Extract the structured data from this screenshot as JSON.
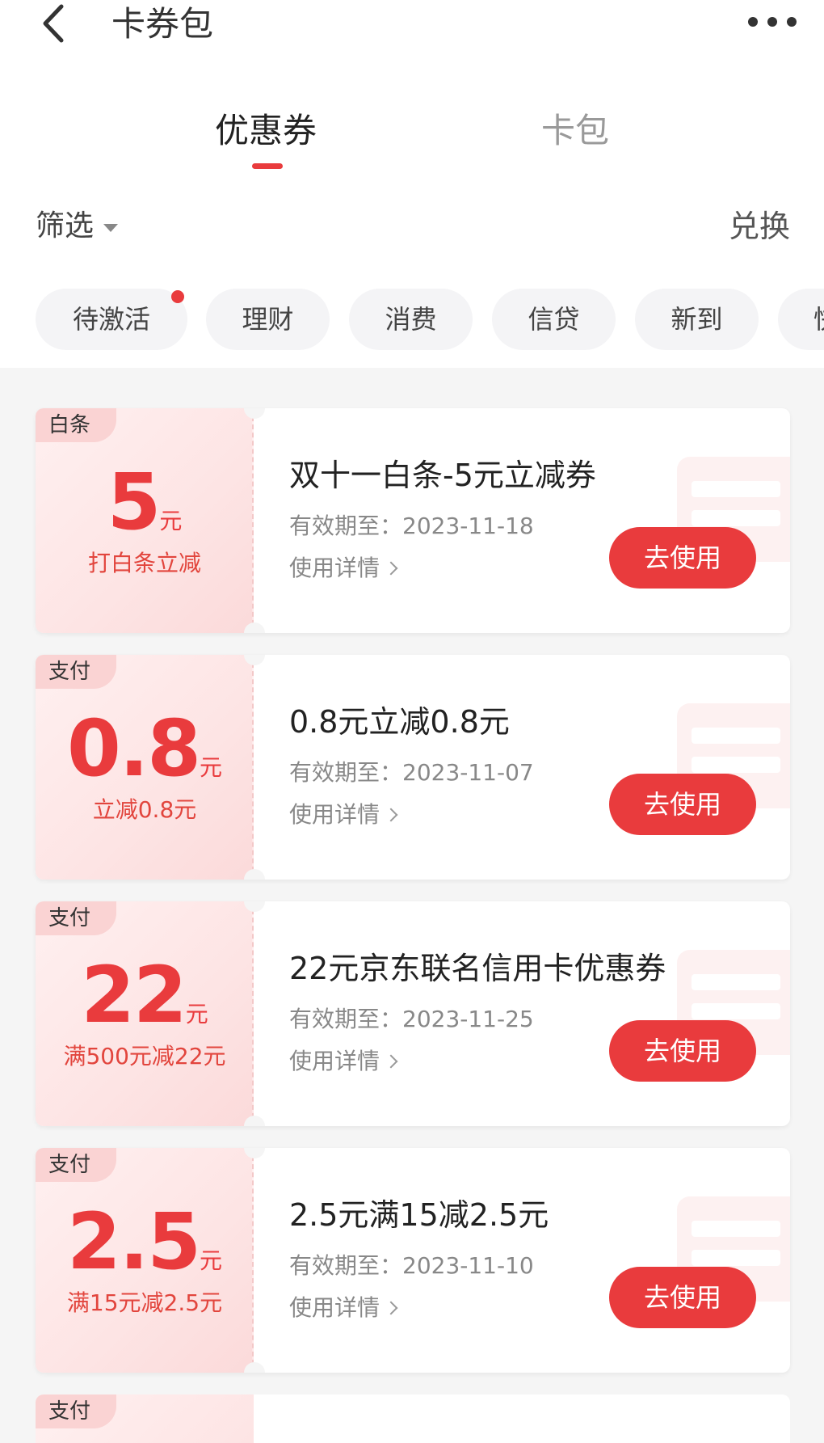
{
  "header": {
    "title": "卡券包"
  },
  "tabs": [
    {
      "label": "优惠券",
      "active": true
    },
    {
      "label": "卡包",
      "active": false
    }
  ],
  "filter": {
    "label": "筛选"
  },
  "exchange_label": "兑换",
  "chips": [
    {
      "label": "待激活",
      "badge": true
    },
    {
      "label": "理财"
    },
    {
      "label": "消费"
    },
    {
      "label": "信贷"
    },
    {
      "label": "新到"
    },
    {
      "label": "快"
    }
  ],
  "coupons": [
    {
      "tag": "白条",
      "amount": "5",
      "unit": "元",
      "desc": "打白条立减",
      "title": "双十一白条-5元立减券",
      "expiry": "有效期至：2023-11-18",
      "detail": "使用详情",
      "button": "去使用"
    },
    {
      "tag": "支付",
      "amount": "0.8",
      "unit": "元",
      "desc": "立减0.8元",
      "title": "0.8元立减0.8元",
      "expiry": "有效期至：2023-11-07",
      "detail": "使用详情",
      "button": "去使用"
    },
    {
      "tag": "支付",
      "amount": "22",
      "unit": "元",
      "desc": "满500元减22元",
      "title": "22元京东联名信用卡优惠券",
      "expiry": "有效期至：2023-11-25",
      "detail": "使用详情",
      "button": "去使用"
    },
    {
      "tag": "支付",
      "amount": "2.5",
      "unit": "元",
      "desc": "满15元减2.5元",
      "title": "2.5元满15减2.5元",
      "expiry": "有效期至：2023-11-10",
      "detail": "使用详情",
      "button": "去使用"
    }
  ],
  "partial_coupon": {
    "tag": "支付"
  },
  "colors": {
    "accent": "#e93b3d",
    "stub_bg": "#fde4e4",
    "page_bg": "#f5f5f5"
  }
}
